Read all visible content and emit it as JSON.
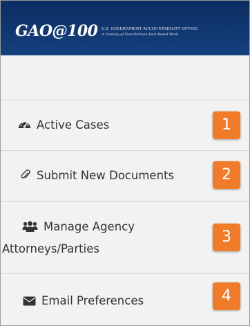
{
  "header": {
    "brand": "GAO@100",
    "tagline_line1": "U.S. GOVERNMENT ACCOUNTABILITY OFFICE",
    "tagline_line2": "A Century of Non-Partisan Fact-Based Work"
  },
  "nav": [
    {
      "label": "Active Cases",
      "icon": "dashboard-icon",
      "badge": "1"
    },
    {
      "label": "Submit New Documents",
      "icon": "paperclip-icon",
      "badge": "2"
    },
    {
      "label_line1": "Manage Agency",
      "label_line2": "Attorneys/Parties",
      "icon": "users-icon",
      "badge": "3"
    },
    {
      "label": "Email Preferences",
      "icon": "envelope-icon",
      "badge": "4"
    }
  ],
  "colors": {
    "header_bg": "#0c2d62",
    "badge_bg": "#f07c2b",
    "panel_bg": "#f2f2f2"
  }
}
